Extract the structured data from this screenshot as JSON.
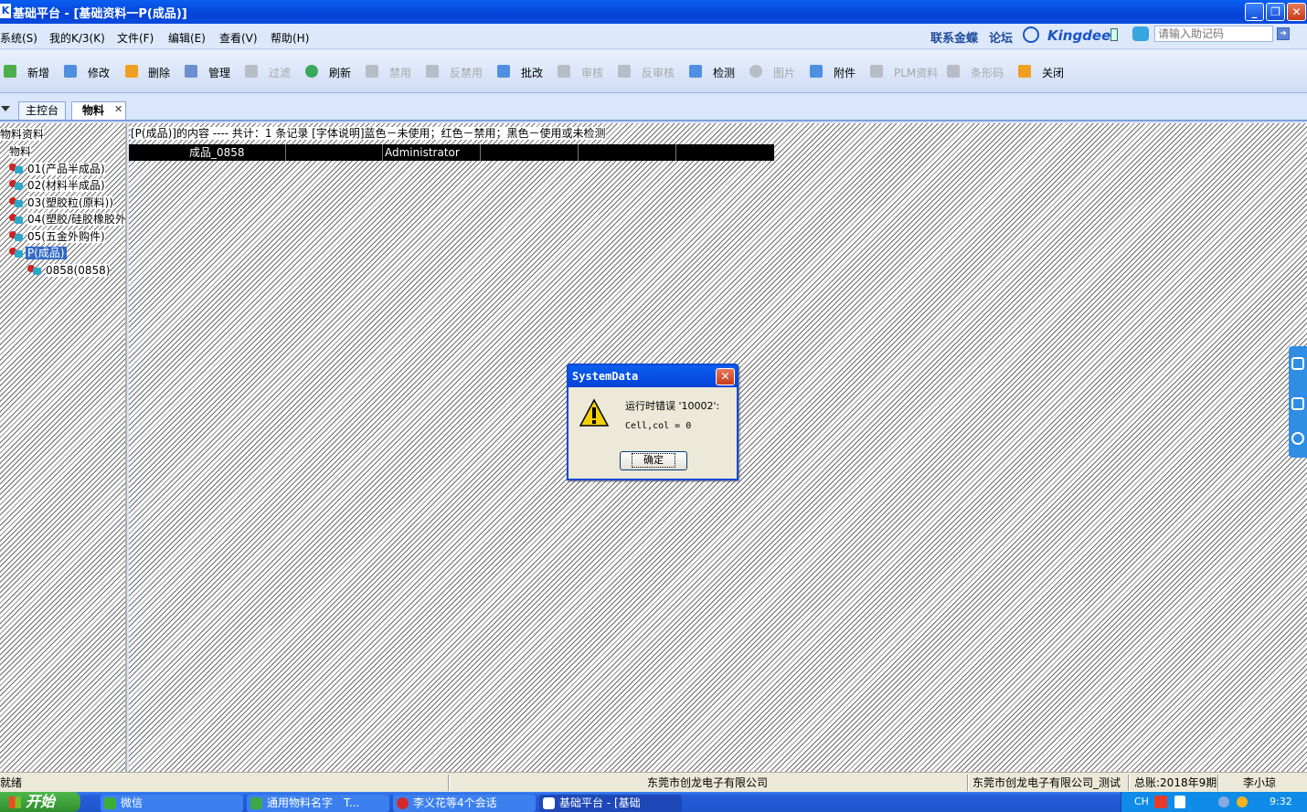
{
  "window": {
    "title": "基础平台 - [基础资料一P(成品)]",
    "app_icon": "K",
    "controls": [
      "minimize-icon",
      "restore-icon",
      "close-icon"
    ]
  },
  "menubar": {
    "items": [
      "系统(S)",
      "我的K/3(K)",
      "文件(F)",
      "编辑(E)",
      "查看(V)",
      "帮助(H)"
    ],
    "links": {
      "contact": "联系金蝶",
      "forum": "论坛"
    },
    "logo_text": "Kingdee",
    "helper_placeholder": "请输入助记码"
  },
  "toolbar": {
    "buttons": [
      {
        "label": "新增",
        "icon": "add-icon",
        "enabled": true
      },
      {
        "label": "修改",
        "icon": "edit-icon",
        "enabled": true
      },
      {
        "label": "删除",
        "icon": "delete-icon",
        "enabled": true
      },
      {
        "label": "管理",
        "icon": "tools-icon",
        "enabled": true
      },
      {
        "label": "过滤",
        "icon": "filter-icon",
        "enabled": false
      },
      {
        "label": "刷新",
        "icon": "refresh-icon",
        "enabled": true
      },
      {
        "label": "禁用",
        "icon": "disable-icon",
        "enabled": false
      },
      {
        "label": "反禁用",
        "icon": "enable-icon",
        "enabled": false
      },
      {
        "label": "批改",
        "icon": "batch-edit-icon",
        "enabled": true
      },
      {
        "label": "审核",
        "icon": "audit-icon",
        "enabled": false
      },
      {
        "label": "反审核",
        "icon": "unaudit-icon",
        "enabled": false
      },
      {
        "label": "检测",
        "icon": "check-icon",
        "enabled": true
      },
      {
        "label": "图片",
        "icon": "picture-icon",
        "enabled": false
      },
      {
        "label": "附件",
        "icon": "attachment-icon",
        "enabled": true
      },
      {
        "label": "PLM资料",
        "icon": "plm-icon",
        "enabled": false
      },
      {
        "label": "条形码",
        "icon": "barcode-icon",
        "enabled": false
      },
      {
        "label": "关闭",
        "icon": "close-door-icon",
        "enabled": true
      }
    ]
  },
  "tabs": [
    {
      "label": "主控台",
      "active": false
    },
    {
      "label": "物料",
      "active": true
    }
  ],
  "tree": {
    "header": "物料资料",
    "root": "物料",
    "nodes": [
      "01(产品半成品)",
      "02(材料半成品)",
      "03(塑胶粒(原料))",
      "04(塑胶/硅胶橡胶外",
      "05(五金外购件)",
      "P(成品)"
    ],
    "selected": "P(成品)",
    "child": "0858(0858)"
  },
  "content": {
    "summary": "[P(成品)]的内容 ---- 共计：1 条记录 [字体说明]蓝色－未使用；红色－禁用；黑色－使用或未检测",
    "row": [
      "成品_0858",
      "",
      "Administrator",
      "",
      "",
      ""
    ]
  },
  "dialog": {
    "title": "SystemData",
    "message": "运行时错误 '10002':",
    "detail": "Cell,col = 0",
    "ok_label": "确定"
  },
  "statusbar": {
    "status": "就绪",
    "company": "东莞市创龙电子有限公司",
    "account": "东莞市创龙电子有限公司_测试",
    "period": "总账:2018年9期",
    "user": "李小琼"
  },
  "taskbar": {
    "start_label": "开始",
    "tasks": [
      "微信",
      "通用物料名字　T...",
      "李义花等4个会话",
      "基础平台 - [基础"
    ],
    "active_task": "基础平台 - [基础",
    "tray": {
      "lang": "CH",
      "time": "9:32"
    }
  },
  "colors": {
    "title_blue": "#0542d8",
    "selection": "#316ac5",
    "disabled_text": "#a7a7a7",
    "accent_blue": "#1a56c8"
  }
}
